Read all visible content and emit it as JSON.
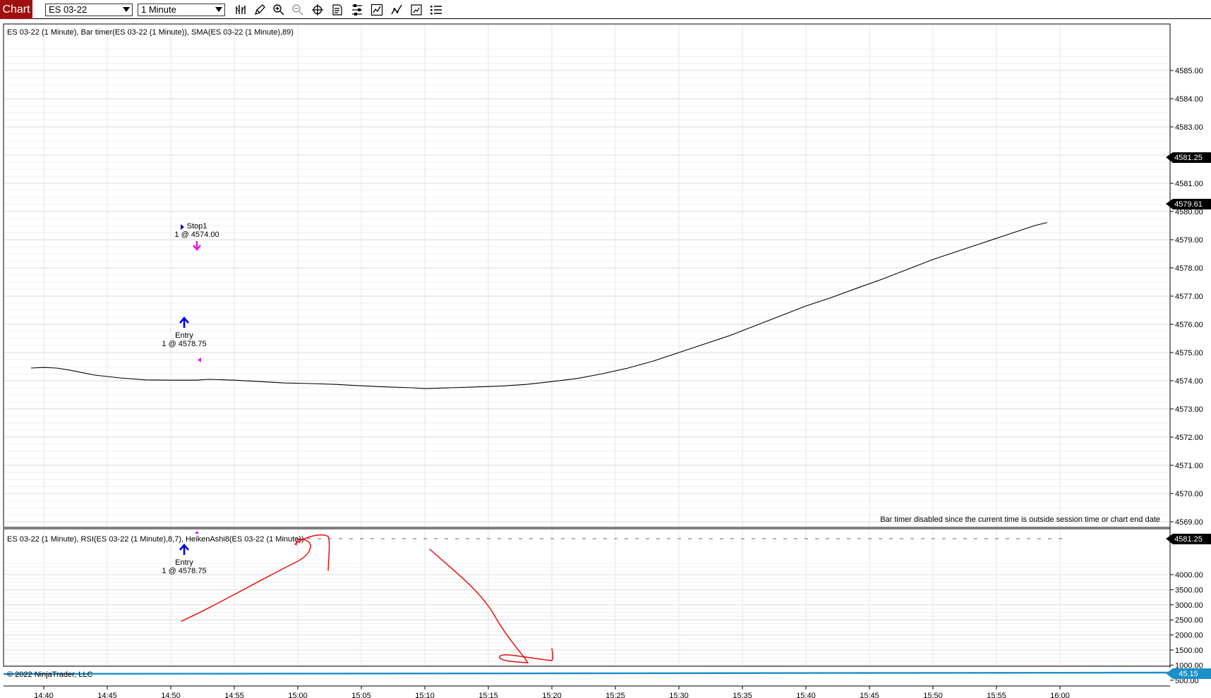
{
  "toolbar": {
    "chart_tab": "Chart",
    "instrument": "ES 03-22",
    "interval": "1 Minute",
    "tools": [
      "bar-type-icon",
      "drawing-pencil-icon",
      "zoom-in-icon",
      "zoom-out-icon",
      "crosshair-icon",
      "data-box-icon",
      "properties-icon",
      "indicators-icon",
      "strategies-icon",
      "templates-icon",
      "list-icon"
    ]
  },
  "price_panel": {
    "title": "ES 03-22 (1 Minute), Bar timer(ES 03-22 (1 Minute)), SMA(ES 03-22 (1 Minute),89)",
    "bar_timer_message": "Bar timer disabled since the current time is outside session time or chart end date",
    "y_labels": [
      "4585.00",
      "4584.00",
      "4583.00",
      "4582.00",
      "4581.00",
      "4580.00",
      "4579.00",
      "4578.00",
      "4577.00",
      "4576.00",
      "4575.00",
      "4574.00",
      "4573.00",
      "4572.00",
      "4571.00",
      "4570.00",
      "4569.00"
    ],
    "price_marker_1": "4581.25",
    "price_marker_2": "4579.61",
    "stop_label": "Stop1",
    "stop_detail": "1 @ 4574.00",
    "entry_label": "Entry",
    "entry_detail": "1 @ 4578.75",
    "colors": {
      "line": "#000000",
      "stop_marker": "#e020e0",
      "entry_marker": "#0000e0",
      "marker_box": "#000000"
    }
  },
  "indicator_panel": {
    "title": "ES 03-22 (1 Minute), RSI(ES 03-22 (1 Minute),8,7), HeikenAshi8(ES 03-22 (1 Minute))",
    "y_labels": [
      "4000.00",
      "3500.00",
      "3000.00",
      "2500.00",
      "2000.00",
      "1500.00",
      "1000.00",
      "500.00"
    ],
    "price_marker": "4581.25",
    "rsi_marker": "45.15",
    "entry_label": "Entry",
    "entry_detail": "1 @ 4578.75",
    "copyright": "© 2022 NinjaTrader, LLC",
    "colors": {
      "rsi_line": "#1a8fc8",
      "annotation": "#e01010"
    }
  },
  "x_axis": {
    "labels": [
      "14:40",
      "14:45",
      "14:50",
      "14:55",
      "15:00",
      "15:05",
      "15:10",
      "15:15",
      "15:20",
      "15:25",
      "15:30",
      "15:35",
      "15:40",
      "15:45",
      "15:50",
      "15:55",
      "16:00"
    ]
  },
  "chart_data": {
    "type": "line",
    "series": [
      {
        "x": [
          "14:39",
          "14:40",
          "14:41",
          "14:42",
          "14:44",
          "14:46",
          "14:48",
          "14:50",
          "14:52",
          "14:53",
          "14:55",
          "14:57",
          "14:59",
          "15:01",
          "15:03",
          "15:05",
          "15:07",
          "15:09",
          "15:10",
          "15:12",
          "15:14",
          "15:16",
          "15:18",
          "15:20",
          "15:22",
          "15:24",
          "15:26",
          "15:28",
          "15:30",
          "15:32",
          "15:34",
          "15:36",
          "15:38",
          "15:40",
          "15:42",
          "15:44",
          "15:46",
          "15:48",
          "15:50",
          "15:52",
          "15:54",
          "15:56",
          "15:58",
          "15:59"
        ],
        "values": [
          4574.45,
          4574.47,
          4574.45,
          4574.38,
          4574.2,
          4574.1,
          4574.03,
          4574.02,
          4574.02,
          4574.05,
          4574.02,
          4573.97,
          4573.92,
          4573.9,
          4573.87,
          4573.82,
          4573.78,
          4573.75,
          4573.72,
          4573.75,
          4573.78,
          4573.81,
          4573.87,
          4573.97,
          4574.08,
          4574.25,
          4574.45,
          4574.7,
          4575,
          4575.3,
          4575.6,
          4575.95,
          4576.3,
          4576.65,
          4576.95,
          4577.28,
          4577.6,
          4577.95,
          4578.3,
          4578.6,
          4578.9,
          4579.2,
          4579.5,
          4579.61
        ]
      }
    ],
    "ylim": [
      4568.25,
      4585.55
    ],
    "grid": true
  }
}
